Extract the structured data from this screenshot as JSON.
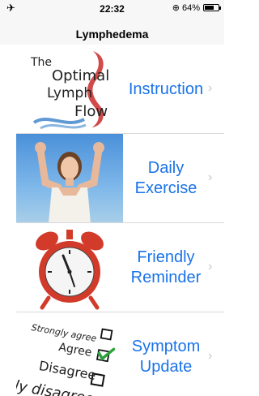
{
  "status_bar": {
    "time": "22:32",
    "battery_percent": "64%",
    "battery_level": 0.64,
    "left_icon": "airplane-icon",
    "lock_icon": "rotation-lock-icon"
  },
  "nav": {
    "title": "Lymphedema"
  },
  "rows": [
    {
      "label_line1": "Instruction",
      "label_line2": "",
      "thumb": {
        "line1": "The",
        "line2": "Optimal",
        "line3": "Lymph",
        "line4": "Flow"
      }
    },
    {
      "label_line1": "Daily",
      "label_line2": "Exercise"
    },
    {
      "label_line1": "Friendly",
      "label_line2": "Reminder"
    },
    {
      "label_line1": "Symptom",
      "label_line2": "Update",
      "thumb": {
        "line1": "Strongly agree",
        "line2": "Agree",
        "line3": "Disagree",
        "line4": "ly disagree"
      }
    }
  ],
  "colors": {
    "accent": "#1a73e8",
    "chevron": "#c7c7cc",
    "separator": "#d9d9de"
  }
}
